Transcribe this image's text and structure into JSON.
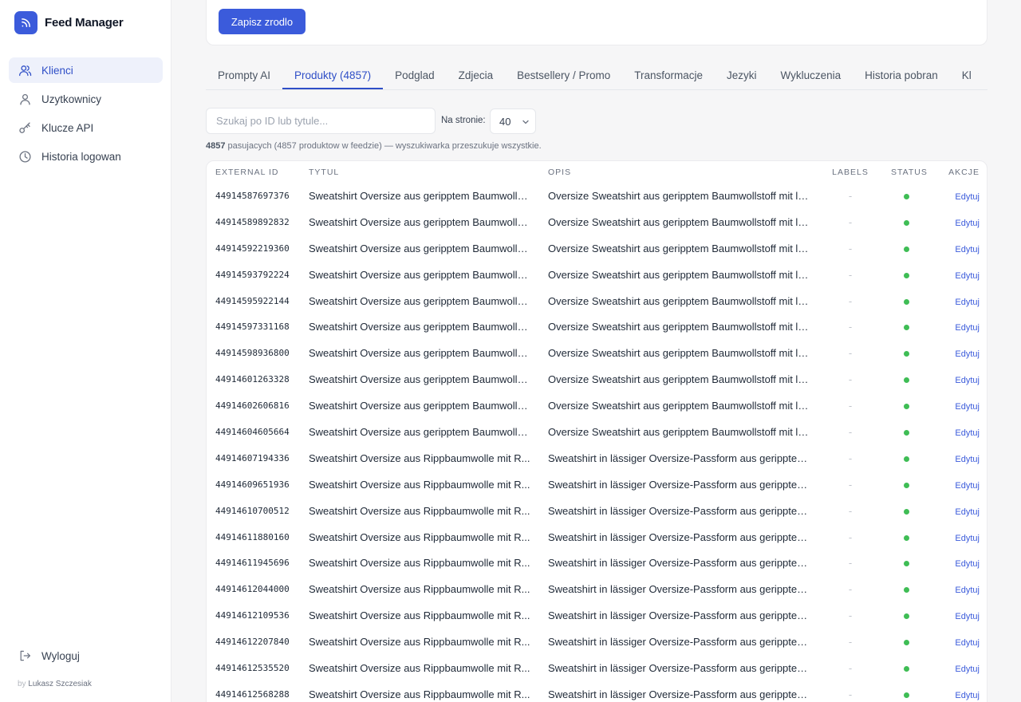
{
  "app": {
    "name": "Feed Manager"
  },
  "sidebar": {
    "items": [
      {
        "label": "Klienci",
        "icon": "users-icon",
        "active": true
      },
      {
        "label": "Uzytkownicy",
        "icon": "user-icon",
        "active": false
      },
      {
        "label": "Klucze API",
        "icon": "key-icon",
        "active": false
      },
      {
        "label": "Historia logowan",
        "icon": "clock-icon",
        "active": false
      }
    ],
    "logout_label": "Wyloguj",
    "byline_prefix": "by",
    "byline_name": "Lukasz Szczesiak"
  },
  "toolbar": {
    "save_label": "Zapisz zrodlo"
  },
  "tabs": [
    {
      "label": "Prompty AI",
      "active": false
    },
    {
      "label": "Produkty (4857)",
      "active": true
    },
    {
      "label": "Podglad",
      "active": false
    },
    {
      "label": "Zdjecia",
      "active": false
    },
    {
      "label": "Bestsellery / Promo",
      "active": false
    },
    {
      "label": "Transformacje",
      "active": false
    },
    {
      "label": "Jezyki",
      "active": false
    },
    {
      "label": "Wykluczenia",
      "active": false
    },
    {
      "label": "Historia pobran",
      "active": false
    },
    {
      "label": "Kl",
      "active": false
    }
  ],
  "search": {
    "placeholder": "Szukaj po ID lub tytule...",
    "value": ""
  },
  "per_page": {
    "label": "Na stronie:",
    "value": "40"
  },
  "summary": {
    "count": "4857",
    "text": "pasujacych (4857 produktow w feedzie) — wyszukiwarka przeszukuje wszystkie."
  },
  "table": {
    "columns": [
      "EXTERNAL ID",
      "TYTUL",
      "OPIS",
      "LABELS",
      "STATUS",
      "AKCJE"
    ],
    "action_label": "Edytuj",
    "status_color": "#3fbd55",
    "rows": [
      {
        "id": "44914587697376",
        "title": "Sweatshirt Oversize aus geripptem Baumwolls...",
        "desc": "Oversize Sweatshirt aus geripptem Baumwollstoff mit lo...",
        "labels": "-"
      },
      {
        "id": "44914589892832",
        "title": "Sweatshirt Oversize aus geripptem Baumwolls...",
        "desc": "Oversize Sweatshirt aus geripptem Baumwollstoff mit lo...",
        "labels": "-"
      },
      {
        "id": "44914592219360",
        "title": "Sweatshirt Oversize aus geripptem Baumwolls...",
        "desc": "Oversize Sweatshirt aus geripptem Baumwollstoff mit lo...",
        "labels": "-"
      },
      {
        "id": "44914593792224",
        "title": "Sweatshirt Oversize aus geripptem Baumwolls...",
        "desc": "Oversize Sweatshirt aus geripptem Baumwollstoff mit lo...",
        "labels": "-"
      },
      {
        "id": "44914595922144",
        "title": "Sweatshirt Oversize aus geripptem Baumwolls...",
        "desc": "Oversize Sweatshirt aus geripptem Baumwollstoff mit lo...",
        "labels": "-"
      },
      {
        "id": "44914597331168",
        "title": "Sweatshirt Oversize aus geripptem Baumwolls...",
        "desc": "Oversize Sweatshirt aus geripptem Baumwollstoff mit lo...",
        "labels": "-"
      },
      {
        "id": "44914598936800",
        "title": "Sweatshirt Oversize aus geripptem Baumwolls...",
        "desc": "Oversize Sweatshirt aus geripptem Baumwollstoff mit lo...",
        "labels": "-"
      },
      {
        "id": "44914601263328",
        "title": "Sweatshirt Oversize aus geripptem Baumwolls...",
        "desc": "Oversize Sweatshirt aus geripptem Baumwollstoff mit lo...",
        "labels": "-"
      },
      {
        "id": "44914602606816",
        "title": "Sweatshirt Oversize aus geripptem Baumwolls...",
        "desc": "Oversize Sweatshirt aus geripptem Baumwollstoff mit lo...",
        "labels": "-"
      },
      {
        "id": "44914604605664",
        "title": "Sweatshirt Oversize aus geripptem Baumwolls...",
        "desc": "Oversize Sweatshirt aus geripptem Baumwollstoff mit lo...",
        "labels": "-"
      },
      {
        "id": "44914607194336",
        "title": "Sweatshirt Oversize aus Rippbaumwolle mit R...",
        "desc": "Sweatshirt in lässiger Oversize-Passform aus geripptem ...",
        "labels": "-"
      },
      {
        "id": "44914609651936",
        "title": "Sweatshirt Oversize aus Rippbaumwolle mit R...",
        "desc": "Sweatshirt in lässiger Oversize-Passform aus geripptem ...",
        "labels": "-"
      },
      {
        "id": "44914610700512",
        "title": "Sweatshirt Oversize aus Rippbaumwolle mit R...",
        "desc": "Sweatshirt in lässiger Oversize-Passform aus geripptem ...",
        "labels": "-"
      },
      {
        "id": "44914611880160",
        "title": "Sweatshirt Oversize aus Rippbaumwolle mit R...",
        "desc": "Sweatshirt in lässiger Oversize-Passform aus geripptem ...",
        "labels": "-"
      },
      {
        "id": "44914611945696",
        "title": "Sweatshirt Oversize aus Rippbaumwolle mit R...",
        "desc": "Sweatshirt in lässiger Oversize-Passform aus geripptem ...",
        "labels": "-"
      },
      {
        "id": "44914612044000",
        "title": "Sweatshirt Oversize aus Rippbaumwolle mit R...",
        "desc": "Sweatshirt in lässiger Oversize-Passform aus geripptem ...",
        "labels": "-"
      },
      {
        "id": "44914612109536",
        "title": "Sweatshirt Oversize aus Rippbaumwolle mit R...",
        "desc": "Sweatshirt in lässiger Oversize-Passform aus geripptem ...",
        "labels": "-"
      },
      {
        "id": "44914612207840",
        "title": "Sweatshirt Oversize aus Rippbaumwolle mit R...",
        "desc": "Sweatshirt in lässiger Oversize-Passform aus geripptem ...",
        "labels": "-"
      },
      {
        "id": "44914612535520",
        "title": "Sweatshirt Oversize aus Rippbaumwolle mit R...",
        "desc": "Sweatshirt in lässiger Oversize-Passform aus geripptem ...",
        "labels": "-"
      },
      {
        "id": "44914612568288",
        "title": "Sweatshirt Oversize aus Rippbaumwolle mit R...",
        "desc": "Sweatshirt in lässiger Oversize-Passform aus geripptem ...",
        "labels": "-"
      }
    ]
  }
}
